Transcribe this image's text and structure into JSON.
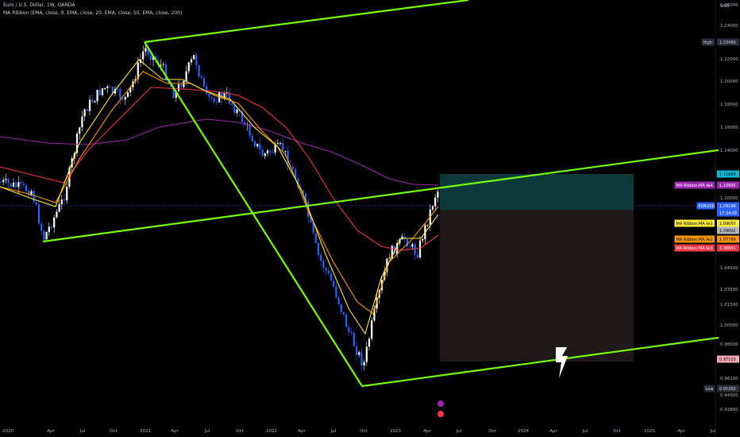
{
  "header": {
    "title": "Euro / U.S. Dollar, 1W, OANDA",
    "indicator": "MA Ribbon (EMA, close, 9, EMA, close, 20, EMA, close, 50, EMA, close, 200)"
  },
  "axis": {
    "currency": "USD",
    "y_ticks": [
      "1.26000",
      "1.24000",
      "1.22000",
      "1.20000",
      "1.18000",
      "1.16000",
      "1.14000",
      "1.10000",
      "1.04500",
      "1.03500",
      "1.01500",
      "1.00000",
      "0.98500",
      "0.96100",
      "0.94900",
      "0.93800"
    ],
    "x_ticks": [
      "2020",
      "Apr",
      "Jul",
      "Oct",
      "2021",
      "Apr",
      "Jul",
      "Oct",
      "2022",
      "Apr",
      "Jul",
      "Oct",
      "2023",
      "Apr",
      "Jul",
      "Oct",
      "2024",
      "Apr",
      "Jul",
      "Oct",
      "2025",
      "Apr",
      "Jul"
    ]
  },
  "price_tags": [
    {
      "label": "High",
      "value": "1.23496",
      "bg": "#2a2e39",
      "fg": "#d1d4dc"
    },
    {
      "label": "",
      "value": "1.11888",
      "bg": "#00bcd4",
      "fg": "#000000"
    },
    {
      "label": "MA Ribbon:MA №4",
      "value": "1.10995",
      "bg": "#9c27b0",
      "fg": "#ffffff"
    },
    {
      "label": "EURUSD",
      "value": "1.09198",
      "bg": "#2962ff",
      "fg": "#ffffff"
    },
    {
      "label": "",
      "value": "17:34:05",
      "bg": "#2962ff",
      "fg": "#ffffff"
    },
    {
      "label": "MA Ribbon:MA №1",
      "value": "1.09050",
      "bg": "#ffeb3b",
      "fg": "#000000"
    },
    {
      "label": "",
      "value": "1.09002",
      "bg": "#b2b5be",
      "fg": "#000000"
    },
    {
      "label": "MA Ribbon:MA №2",
      "value": "1.07789",
      "bg": "#ff9800",
      "fg": "#000000"
    },
    {
      "label": "MA Ribbon:MA №3",
      "value": "1.06841",
      "bg": "#f23645",
      "fg": "#ffffff"
    },
    {
      "label": "",
      "value": "0.97103",
      "bg": "#f7a8b8",
      "fg": "#000000"
    },
    {
      "label": "Low",
      "value": "0.95260",
      "bg": "#2a2e39",
      "fg": "#d1d4dc"
    }
  ],
  "colors": {
    "trendline": "#76ff03",
    "ma1": "#ffeb3b",
    "ma2": "#ff9800",
    "ma3": "#f23645",
    "ma4": "#9c27b0",
    "up": "#ffffff",
    "down": "#2962ff",
    "target_zone": "#004d4d",
    "stop_zone": "#2b1f1f"
  },
  "chart_data": {
    "type": "candlestick",
    "symbol": "EURUSD",
    "timeframe": "1W",
    "close_path": [
      [
        "2020-03",
        1.085
      ],
      [
        "2020-06",
        1.13
      ],
      [
        "2020-09",
        1.17
      ],
      [
        "2020-12",
        1.22
      ],
      [
        "2021-01",
        1.225
      ],
      [
        "2021-03",
        1.175
      ],
      [
        "2021-05",
        1.22
      ],
      [
        "2021-07",
        1.18
      ],
      [
        "2021-09",
        1.16
      ],
      [
        "2021-11",
        1.13
      ],
      [
        "2022-01",
        1.13
      ],
      [
        "2022-04",
        1.05
      ],
      [
        "2022-07",
        1.01
      ],
      [
        "2022-09",
        0.96
      ],
      [
        "2022-10",
        0.98
      ],
      [
        "2022-12",
        1.06
      ],
      [
        "2023-02",
        1.07
      ],
      [
        "2023-04",
        1.1
      ]
    ],
    "ma_series": [
      {
        "name": "MA Ribbon:MA №1",
        "last": 1.0905
      },
      {
        "name": "MA Ribbon:MA №2",
        "last": 1.07789
      },
      {
        "name": "MA Ribbon:MA №3",
        "last": 1.06841
      },
      {
        "name": "MA Ribbon:MA №4",
        "last": 1.10995
      }
    ],
    "high": 1.23496,
    "low": 0.9526
  }
}
